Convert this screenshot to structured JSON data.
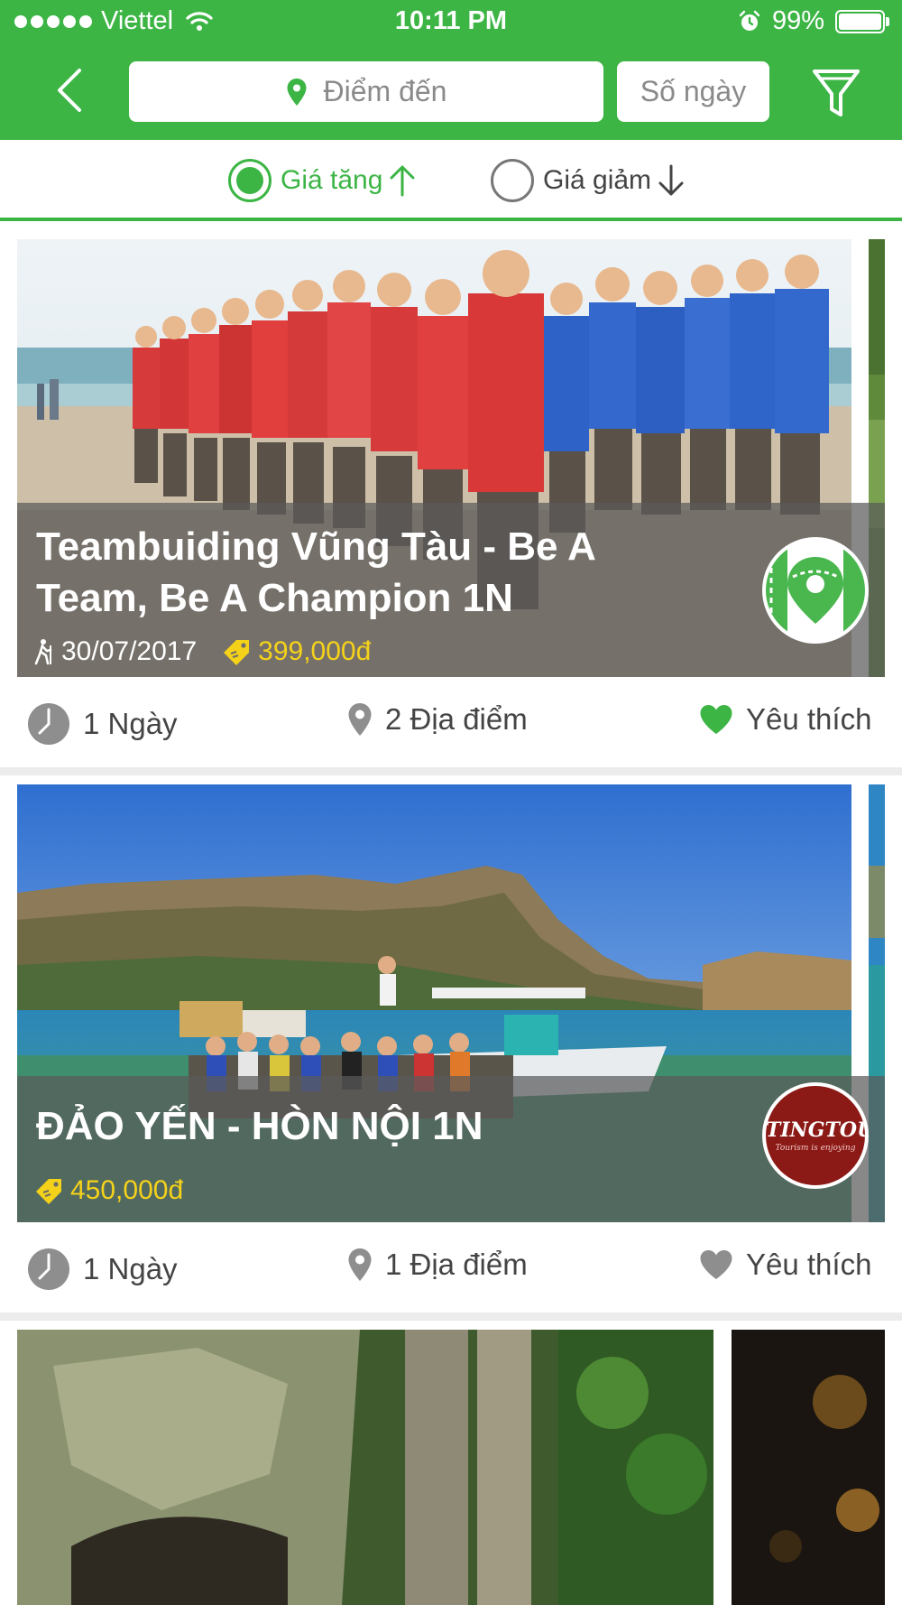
{
  "status_bar": {
    "carrier": "Viettel",
    "time": "10:11 PM",
    "battery": "99%"
  },
  "search": {
    "destination_placeholder": "Điểm đến",
    "days_placeholder": "Số ngày"
  },
  "sort": {
    "asc_label": "Giá tăng",
    "desc_label": "Giá giảm",
    "selected": "asc"
  },
  "colors": {
    "brand_green": "#3cb545",
    "price_yellow": "#f5d21a"
  },
  "tours": [
    {
      "title": "Teambuiding  Vũng Tàu - Be A Team, Be A Champion 1N",
      "date": "30/07/2017",
      "price": "399,000đ",
      "duration": "1 Ngày",
      "places": "2 Địa điểm",
      "favorite_label": "Yêu thích",
      "favorited": true
    },
    {
      "title": "ĐẢO YẾN - HÒN NỘI 1N",
      "price": "450,000đ",
      "duration": "1 Ngày",
      "places": "1 Địa điểm",
      "favorite_label": "Yêu thích",
      "favorited": false,
      "operator_logo_text": "TINGTOUR",
      "operator_logo_slogan": "Tourism is enjoying"
    }
  ]
}
